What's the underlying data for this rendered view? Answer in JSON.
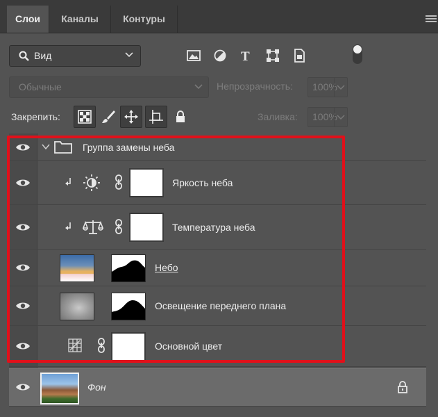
{
  "tabs": [
    {
      "label": "Слои",
      "active": true
    },
    {
      "label": "Каналы",
      "active": false
    },
    {
      "label": "Контуры",
      "active": false
    }
  ],
  "filter": {
    "label": "Вид"
  },
  "blend_mode": {
    "value": "Обычные"
  },
  "opacity": {
    "label": "Непрозрачность:",
    "value": "100%"
  },
  "lock": {
    "label": "Закрепить:"
  },
  "fill": {
    "label": "Заливка:",
    "value": "100%"
  },
  "layers": [
    {
      "name": "Группа замены неба",
      "type": "group"
    },
    {
      "name": "Яркость неба",
      "type": "adjustment-brightness"
    },
    {
      "name": "Температура неба",
      "type": "adjustment-balance"
    },
    {
      "name": "Небо",
      "type": "image"
    },
    {
      "name": "Освещение переднего плана",
      "type": "image"
    },
    {
      "name": "Основной цвет",
      "type": "fill"
    },
    {
      "name": "Фон",
      "type": "background",
      "selected": true,
      "locked": true
    }
  ],
  "colors": {
    "panel": "#535353",
    "tabbar": "#3a3a3a",
    "highlight": "#e1101a",
    "selected_row": "#6b6b6b"
  }
}
